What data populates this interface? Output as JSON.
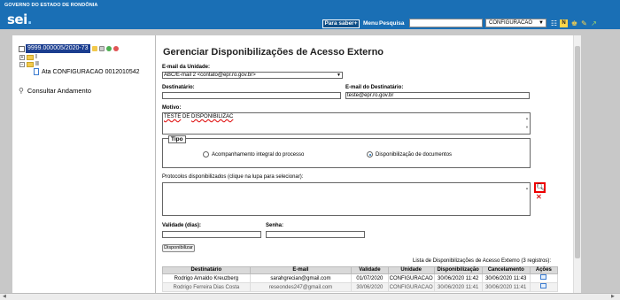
{
  "header": {
    "gov_title": "GOVERNO DO ESTADO DE RONDÔNIA",
    "logo": "sei",
    "logo_dot": ".",
    "para_saber": "Para saber+",
    "menu": "Menu",
    "pesquisa": "Pesquisa",
    "search_value": "",
    "unit": "CONFIGURACAO",
    "icons": [
      "grid-icon",
      "notification-icon",
      "user-icon",
      "tools-icon",
      "exit-icon"
    ]
  },
  "sidebar": {
    "process_number": "9999.000005/2020-73",
    "folder1": "I",
    "folder2": "II",
    "document": "Ata CONFIGURACAO 0012010542",
    "consultar": "Consultar Andamento"
  },
  "form": {
    "title": "Gerenciar Disponibilizações de Acesso Externo",
    "email_unidade_label": "E-mail da Unidade:",
    "email_unidade_value": "ABC/E-mail 2 <contato@epr.ro.gov.br>",
    "destinatario_label": "Destinatário:",
    "destinatario_value": "",
    "email_destinatario_label": "E-mail do Destinatário:",
    "email_destinatario_value": "teste@epr.ro.gov.br",
    "motivo_label": "Motivo:",
    "motivo_word1": "TESTE",
    "motivo_word2": "DE",
    "motivo_word3": "DISPONIBILIZAC",
    "tipo_legend": "Tipo",
    "tipo_option1": "Acompanhamento integral do processo",
    "tipo_option2": "Disponibilização de documentos",
    "tipo_selected": "Disponibilização de documentos",
    "protocolos_label": "Protocolos disponibilizados (clique na lupa para selecionar):",
    "validade_label": "Validade (dias):",
    "validade_value": "",
    "senha_label": "Senha:",
    "senha_value": "",
    "disponibilizar_button": "Disponibilizar"
  },
  "table": {
    "caption": "Lista de Disponibilizações de Acesso Externo (3 registros):",
    "headers": [
      "Destinatário",
      "E-mail",
      "Validade",
      "Unidade",
      "Disponibilização",
      "Cancelamento",
      "Ações"
    ],
    "rows": [
      [
        "Rodrigo Arnaldo Kreuzberg",
        "sarahgrecian@gmail.com",
        "01/07/2020",
        "CONFIGURACAO",
        "30/06/2020 11:42",
        "30/06/2020 11:43"
      ],
      [
        "Rodrigo Ferreira Dias Costa",
        "reseondes247@gmail.com",
        "30/06/2020",
        "CONFIGURACAO",
        "30/06/2020 11:41",
        "30/06/2020 11:41"
      ]
    ]
  },
  "colors": {
    "header_blue": "#1a6fb5",
    "process_highlight": "#1a3d8f",
    "lupa_border": "#e00000"
  }
}
